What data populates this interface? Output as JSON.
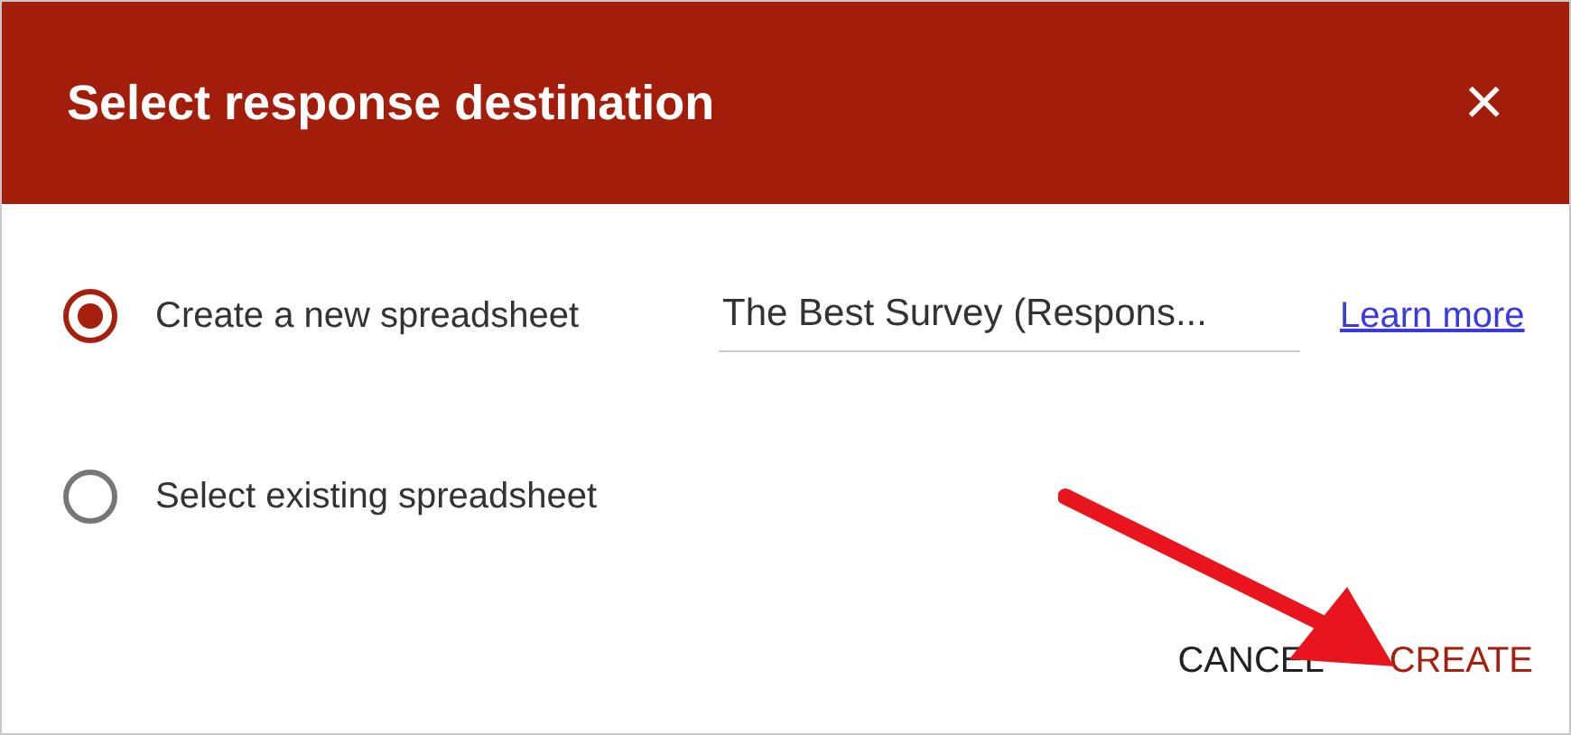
{
  "dialog": {
    "title": "Select response destination",
    "close": "×"
  },
  "options": [
    {
      "label": "Create a new spreadsheet",
      "selected": true,
      "kind": "new",
      "field_value": "The Best Survey (Respons...",
      "link": "Learn more"
    },
    {
      "label": "Select existing spreadsheet",
      "selected": false,
      "kind": "existing"
    }
  ],
  "buttons": [
    {
      "label": "CANCEL",
      "kind": "secondary"
    },
    {
      "label": "CREATE",
      "kind": "primary"
    }
  ]
}
